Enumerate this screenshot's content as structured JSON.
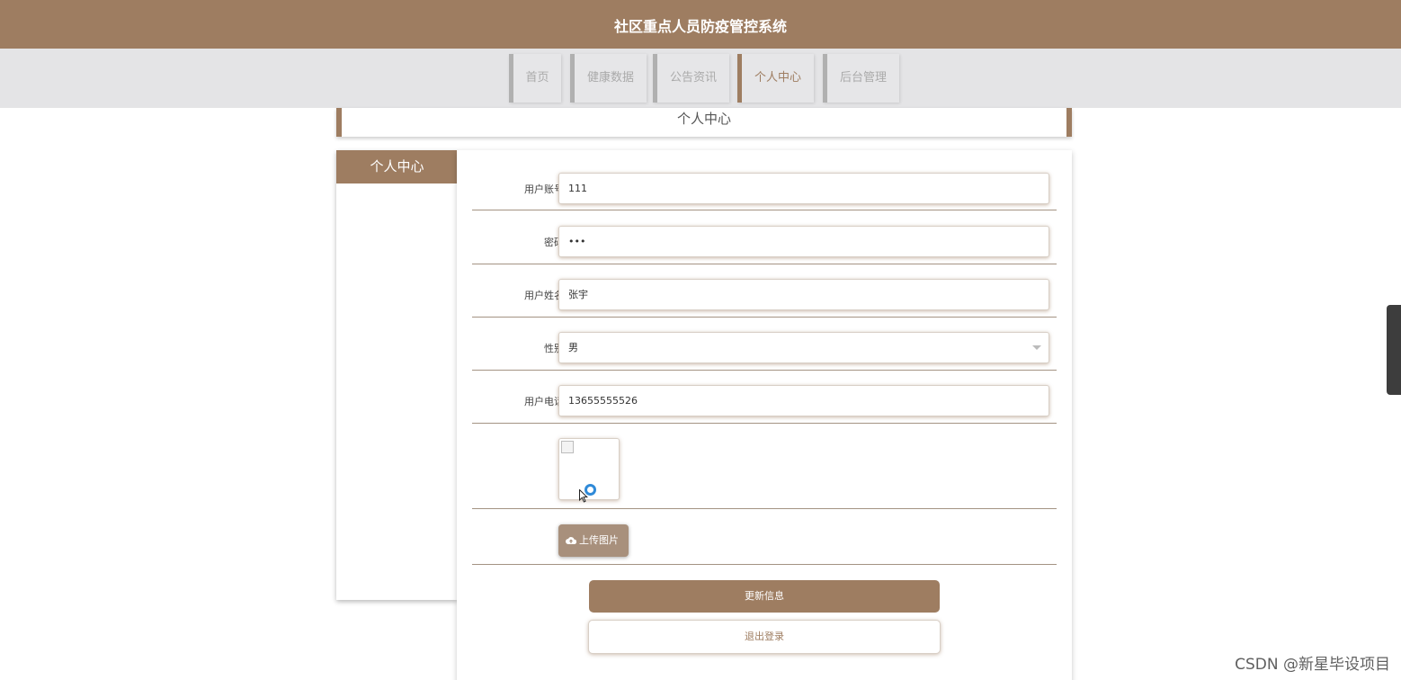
{
  "header": {
    "title": "社区重点人员防疫管控系统"
  },
  "nav": {
    "items": [
      {
        "label": "首页"
      },
      {
        "label": "健康数据"
      },
      {
        "label": "公告资讯"
      },
      {
        "label": "个人中心"
      },
      {
        "label": "后台管理"
      }
    ],
    "active": "个人中心"
  },
  "breadcrumb": {
    "title": "个人中心"
  },
  "sidebar": {
    "heading": "个人中心"
  },
  "form": {
    "account": {
      "label": "用户账号",
      "value": "111"
    },
    "password": {
      "label": "密码",
      "value": "•••"
    },
    "name": {
      "label": "用户姓名",
      "value": "张宇"
    },
    "gender": {
      "label": "性别",
      "value": "男"
    },
    "phone": {
      "label": "用户电话",
      "value": "13655555526"
    },
    "upload_label": "上传图片",
    "update_label": "更新信息",
    "logout_label": "退出登录"
  },
  "watermark": "CSDN @新星毕设项目",
  "colors": {
    "brand": "#9e7d61",
    "nav_bg": "#e4e4e6",
    "upload_btn": "#a8907c"
  },
  "icons": {
    "upload": "cloud-upload-icon",
    "select": "chevron-down-icon",
    "avatar": "broken-image-icon"
  }
}
